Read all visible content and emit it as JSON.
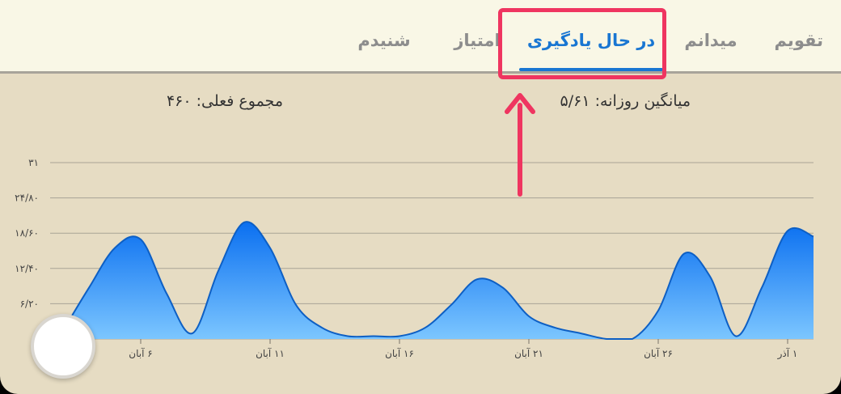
{
  "tabs": [
    {
      "id": "calendar",
      "label": "تقویم",
      "active": false
    },
    {
      "id": "arena",
      "label": "میدانم",
      "active": false
    },
    {
      "id": "learning",
      "label": "در حال یادگیری",
      "active": true
    },
    {
      "id": "score",
      "label": "امتیاز",
      "active": false
    },
    {
      "id": "heard",
      "label": "شنیدم",
      "active": false
    }
  ],
  "stats": {
    "daily_average": "میانگین روزانه: ۵/۶۱",
    "current_total": "مجموع فعلی: ۴۶۰"
  },
  "colors": {
    "accent": "#1976d2",
    "highlight": "#ef3560",
    "area_top": "#0a6ff0",
    "area_bottom": "#7cc6ff"
  },
  "chart_data": {
    "type": "area",
    "y_tick_labels": [
      "۶/۲۰",
      "۱۲/۴۰",
      "۱۸/۶۰",
      "۲۴/۸۰",
      "۳۱"
    ],
    "y_ticks": [
      6.2,
      12.4,
      18.6,
      24.8,
      31
    ],
    "ylim": [
      0,
      31
    ],
    "grid": true,
    "x_tick_labels": [
      "۶ آبان",
      "۱۱ آبان",
      "۱۶ آبان",
      "۲۱ آبان",
      "۲۶ آبان",
      "۱ آذر"
    ],
    "x_ticks": [
      6,
      11,
      16,
      21,
      26,
      31
    ],
    "xlim": [
      3,
      32
    ],
    "x": [
      3,
      4,
      5,
      6,
      7,
      8,
      9,
      10,
      11,
      12,
      13,
      14,
      15,
      16,
      17,
      18,
      19,
      20,
      21,
      22,
      23,
      24,
      25,
      26,
      27,
      28,
      29,
      30,
      31,
      32
    ],
    "values": [
      1.5,
      9,
      16,
      17.5,
      8,
      1,
      12,
      20.5,
      16,
      6,
      2,
      0.5,
      0.5,
      0.5,
      2,
      6,
      10.5,
      9,
      4,
      2,
      1,
      0,
      0,
      5,
      15,
      11,
      0.5,
      9,
      19,
      18
    ]
  }
}
